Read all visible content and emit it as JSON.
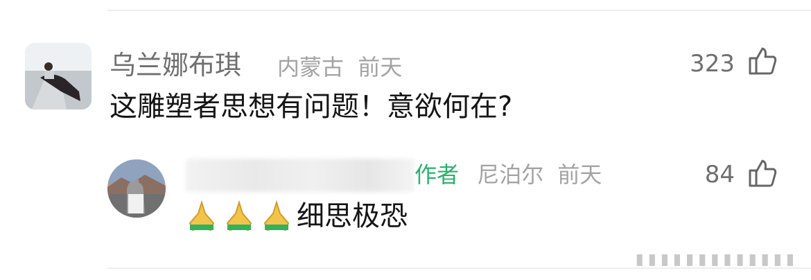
{
  "comment": {
    "username": "乌兰娜布琪",
    "location": "内蒙古",
    "time": "前天",
    "like_count": "323",
    "text": "这雕塑者思想有问题！意欲何在?"
  },
  "reply": {
    "author_tag": "作者",
    "location": "尼泊尔",
    "time": "前天",
    "like_count": "84",
    "text": "细思极恐",
    "emojis": [
      "folded-hands",
      "folded-hands",
      "folded-hands"
    ]
  },
  "icons": {
    "like": "thumbs-up-icon",
    "reaction": "folded-hands-icon"
  },
  "colors": {
    "author_tag": "#27b36b",
    "meta": "#a3a3a3",
    "content": "#151515"
  }
}
